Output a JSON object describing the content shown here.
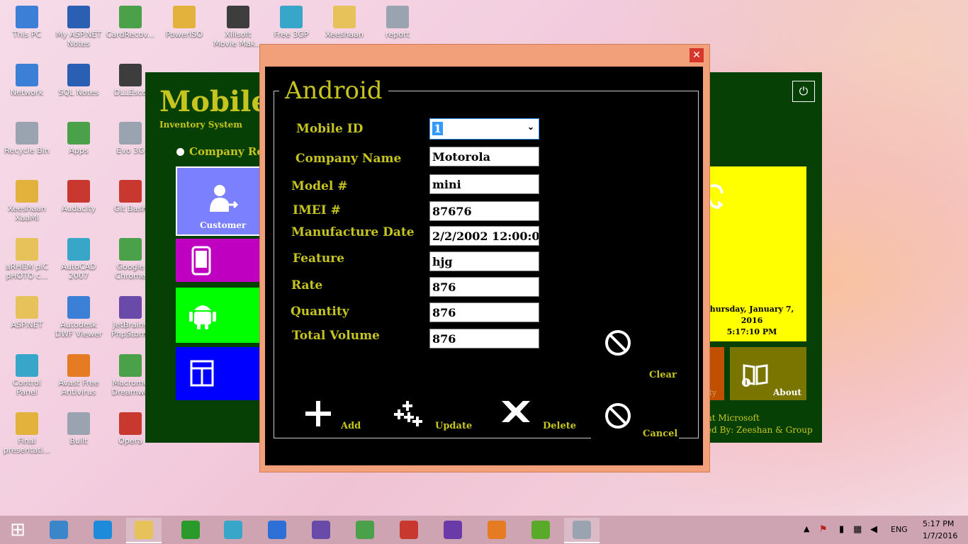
{
  "desktop": {
    "icons": [
      {
        "label": "This PC",
        "icon": "computer-icon",
        "color": "#3b7fd6"
      },
      {
        "label": "My ASP.NET Notes",
        "icon": "word-doc-icon",
        "color": "#2b5fb3"
      },
      {
        "label": "CardRecov...",
        "icon": "card-recovery-icon",
        "color": "#4aa14a"
      },
      {
        "label": "PowerISO",
        "icon": "disc-icon",
        "color": "#e2b23c"
      },
      {
        "label": "Xilisoft Movie Mak...",
        "icon": "film-icon",
        "color": "#3d3d3d"
      },
      {
        "label": "Free 3GP",
        "icon": "phone-icon",
        "color": "#37a6c8"
      },
      {
        "label": "Xeeshaan",
        "icon": "folder-icon",
        "color": "#e7c15a"
      },
      {
        "label": "report",
        "icon": "document-icon",
        "color": "#9aa4b0"
      },
      {
        "label": "Network",
        "icon": "network-icon",
        "color": "#3b7fd6"
      },
      {
        "label": "SQL Notes",
        "icon": "word-doc-icon",
        "color": "#2b5fb3"
      },
      {
        "label": "DLLEsco",
        "icon": "app-icon",
        "color": "#3d3d3d"
      },
      {
        "label": "Recycle Bin",
        "icon": "recycle-bin-icon",
        "color": "#9aa4b0"
      },
      {
        "label": "Apps",
        "icon": "android-apps-icon",
        "color": "#4aa14a"
      },
      {
        "label": "Evo 3G",
        "icon": "app-icon",
        "color": "#9aa4b0"
      },
      {
        "label": "Xeeshaan XaaMi",
        "icon": "user-icon",
        "color": "#e2b23c"
      },
      {
        "label": "Audacity",
        "icon": "headphones-icon",
        "color": "#c9382e"
      },
      {
        "label": "Git Bash",
        "icon": "git-icon",
        "color": "#c9382e"
      },
      {
        "label": "aRHEM piC pHOTO c...",
        "icon": "folder-icon",
        "color": "#e7c15a"
      },
      {
        "label": "AutoCAD 2007",
        "icon": "autocad-icon",
        "color": "#37a6c8"
      },
      {
        "label": "Google Chrome",
        "icon": "chrome-icon",
        "color": "#4aa14a"
      },
      {
        "label": "ASP.NET",
        "icon": "folder-icon",
        "color": "#e7c15a"
      },
      {
        "label": "Autodesk DWF Viewer",
        "icon": "globe-icon",
        "color": "#3b7fd6"
      },
      {
        "label": "JetBrains PhpStorm",
        "icon": "phpstorm-icon",
        "color": "#6a4aa8"
      },
      {
        "label": "Control Panel",
        "icon": "control-panel-icon",
        "color": "#37a6c8"
      },
      {
        "label": "Avast Free Antivirus",
        "icon": "avast-icon",
        "color": "#e57b22"
      },
      {
        "label": "Macrome Dreamwe",
        "icon": "dreamweaver-icon",
        "color": "#4aa14a"
      },
      {
        "label": "Final presentati...",
        "icon": "presentation-icon",
        "color": "#e2b23c"
      },
      {
        "label": "Built",
        "icon": "document-icon",
        "color": "#9aa4b0"
      },
      {
        "label": "Opera",
        "icon": "opera-icon",
        "color": "#c9382e"
      }
    ]
  },
  "bg_app": {
    "title": "Mobile",
    "subtitle": "Inventory System",
    "radio_label": "Company Reco",
    "tiles": {
      "customer_label": "Customer",
      "about_label": "About",
      "activity_partial": "ity"
    },
    "clock": {
      "date_line1": "hursday, January 7,",
      "date_line2": "2016",
      "time": "5:17:10 PM"
    },
    "footer": {
      "copyright": "ht Microsoft",
      "credit": "ed By: Zeeshan & Group"
    },
    "colors": {
      "background": "#074005",
      "accent_text": "#c6c520",
      "tile_yellow": "#ffff00",
      "tile_olive": "#7a7400"
    }
  },
  "dialog": {
    "legend": "Android",
    "fields": [
      {
        "label": "Mobile ID",
        "value": "1",
        "type": "select"
      },
      {
        "label": "Company Name",
        "value": "Motorola",
        "type": "text"
      },
      {
        "label": "Model #",
        "value": "mini",
        "type": "text"
      },
      {
        "label": "IMEI #",
        "value": "87676",
        "type": "text"
      },
      {
        "label": "Manufacture Date",
        "value": "2/2/2002 12:00:0",
        "type": "text"
      },
      {
        "label": "Feature",
        "value": "hjg",
        "type": "text"
      },
      {
        "label": "Rate",
        "value": "876",
        "type": "text"
      },
      {
        "label": "Quantity",
        "value": "876",
        "type": "text"
      },
      {
        "label": "Total Volume",
        "value": "876",
        "type": "text"
      }
    ],
    "actions": {
      "add": "Add",
      "update": "Update",
      "delete": "Delete",
      "clear": "Clear",
      "cancel": "Cancel"
    },
    "colors": {
      "frame": "#f1a079",
      "label": "#c6c520",
      "close": "#d7362b"
    }
  },
  "taskbar": {
    "apps": [
      {
        "icon": "start-icon"
      },
      {
        "icon": "remote-desktop-icon"
      },
      {
        "icon": "internet-explorer-icon"
      },
      {
        "icon": "file-explorer-icon"
      },
      {
        "icon": "store-icon"
      },
      {
        "icon": "network-monitor-icon"
      },
      {
        "icon": "spiral-app-icon"
      },
      {
        "icon": "hexagon-app-icon"
      },
      {
        "icon": "chrome-icon"
      },
      {
        "icon": "opera-icon"
      },
      {
        "icon": "visual-studio-icon"
      },
      {
        "icon": "paint-icon"
      },
      {
        "icon": "bluestacks-icon"
      },
      {
        "icon": "mobile-inventory-app-icon"
      }
    ],
    "language": "ENG",
    "time": "5:17 PM",
    "date": "1/7/2016"
  }
}
